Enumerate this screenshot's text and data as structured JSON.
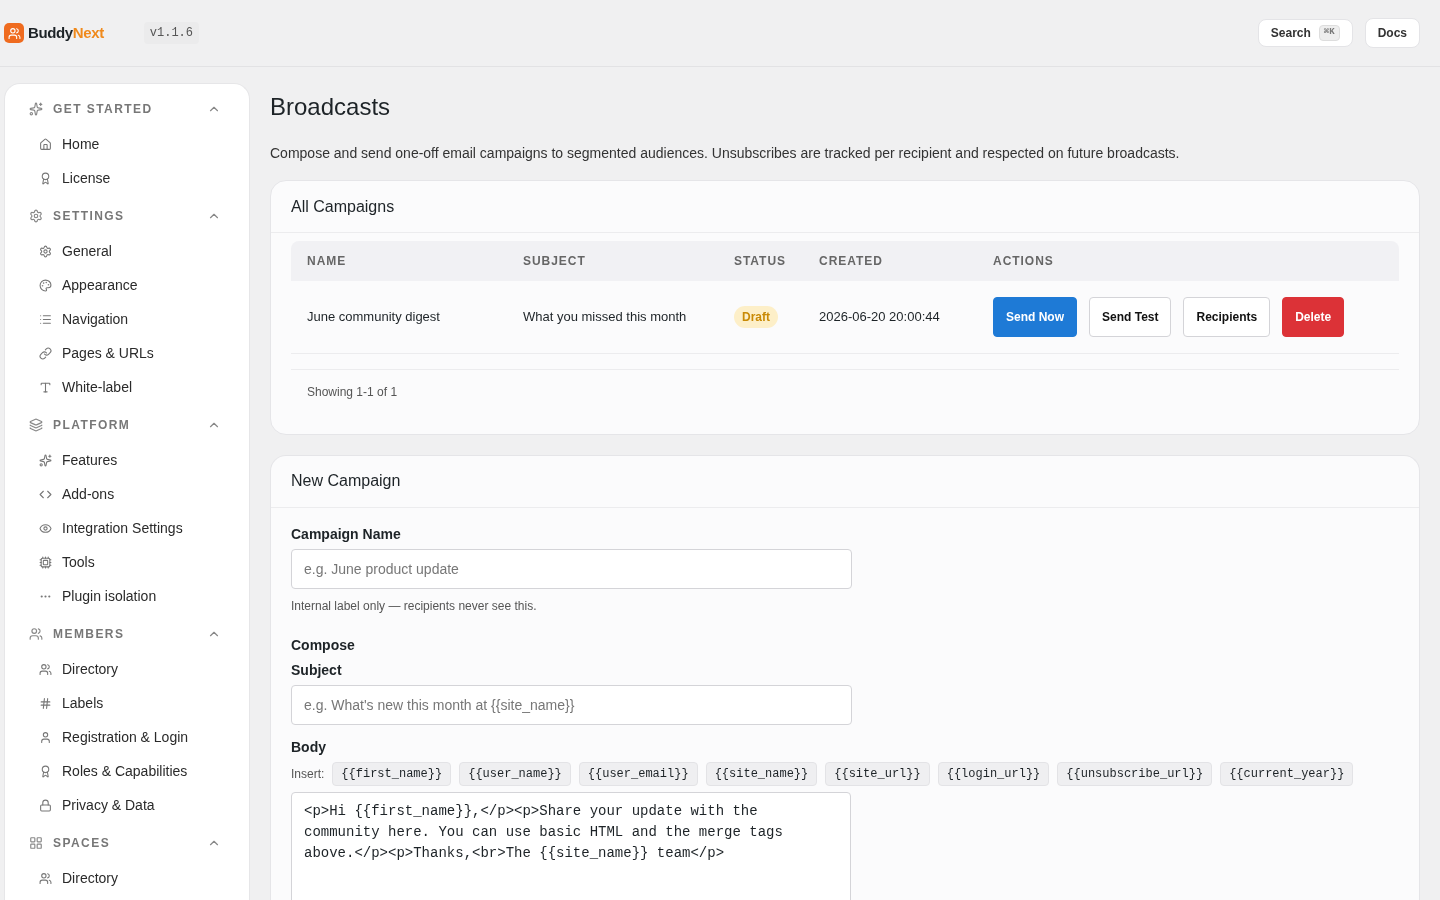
{
  "header": {
    "brand": {
      "first": "Buddy",
      "second": "Next"
    },
    "version": "v1.1.6",
    "search": {
      "label": "Search",
      "shortcut": "⌘K"
    },
    "docs": "Docs"
  },
  "sidebar": {
    "sections": [
      {
        "title": "GET STARTED",
        "expanded": true,
        "items": [
          {
            "label": "Home",
            "selected": false
          },
          {
            "label": "License",
            "selected": false
          }
        ]
      },
      {
        "title": "SETTINGS",
        "expanded": true,
        "items": [
          {
            "label": "General",
            "selected": false
          },
          {
            "label": "Appearance",
            "selected": false
          },
          {
            "label": "Navigation",
            "selected": false
          },
          {
            "label": "Pages & URLs",
            "selected": false
          },
          {
            "label": "White-label",
            "selected": false
          }
        ]
      },
      {
        "title": "PLATFORM",
        "expanded": true,
        "items": [
          {
            "label": "Features",
            "selected": false
          },
          {
            "label": "Add-ons",
            "selected": false
          },
          {
            "label": "Integration Settings",
            "selected": false
          },
          {
            "label": "Tools",
            "selected": false
          },
          {
            "label": "Plugin isolation",
            "selected": false
          }
        ]
      },
      {
        "title": "MEMBERS",
        "expanded": true,
        "items": [
          {
            "label": "Directory",
            "selected": false
          },
          {
            "label": "Labels",
            "selected": false
          },
          {
            "label": "Registration & Login",
            "selected": false
          },
          {
            "label": "Roles & Capabilities",
            "selected": false
          },
          {
            "label": "Privacy & Data",
            "selected": false
          }
        ]
      },
      {
        "title": "SPACES",
        "expanded": true,
        "items": [
          {
            "label": "Directory",
            "selected": false
          }
        ]
      }
    ]
  },
  "page": {
    "title": "Broadcasts",
    "description": "Compose and send one-off email campaigns to segmented audiences. Unsubscribes are tracked per recipient and respected on future broadcasts."
  },
  "campaigns": {
    "title": "All Campaigns",
    "columns": [
      "NAME",
      "SUBJECT",
      "STATUS",
      "CREATED",
      "ACTIONS"
    ],
    "rows": [
      {
        "name": "June community digest",
        "subject": "What you missed this month",
        "status": "Draft",
        "created": "2026-06-20 20:00:44",
        "actions": [
          {
            "label": "Send Now",
            "kind": "primary"
          },
          {
            "label": "Send Test",
            "kind": "outline"
          },
          {
            "label": "Recipients",
            "kind": "outline"
          },
          {
            "label": "Delete",
            "kind": "danger"
          }
        ]
      }
    ],
    "footer": "Showing 1-1 of 1"
  },
  "new_campaign": {
    "title": "New Campaign",
    "name_field": {
      "label": "Campaign Name",
      "placeholder": "e.g. June product update",
      "hint": "Internal label only — recipients never see this."
    },
    "compose_heading": "Compose",
    "subject_field": {
      "label": "Subject",
      "placeholder": "e.g. What's new this month at {{site_name}}"
    },
    "body": {
      "label": "Body",
      "insert_label": "Insert:",
      "tags": [
        "{{first_name}}",
        "{{user_name}}",
        "{{user_email}}",
        "{{site_name}}",
        "{{site_url}}",
        "{{login_url}}",
        "{{unsubscribe_url}}",
        "{{current_year}}"
      ],
      "value": "<p>Hi {{first_name}},</p><p>Share your update with the community here. You can use basic HTML and the merge tags above.</p><p>Thanks,<br>The {{site_name}} team</p>"
    }
  }
}
